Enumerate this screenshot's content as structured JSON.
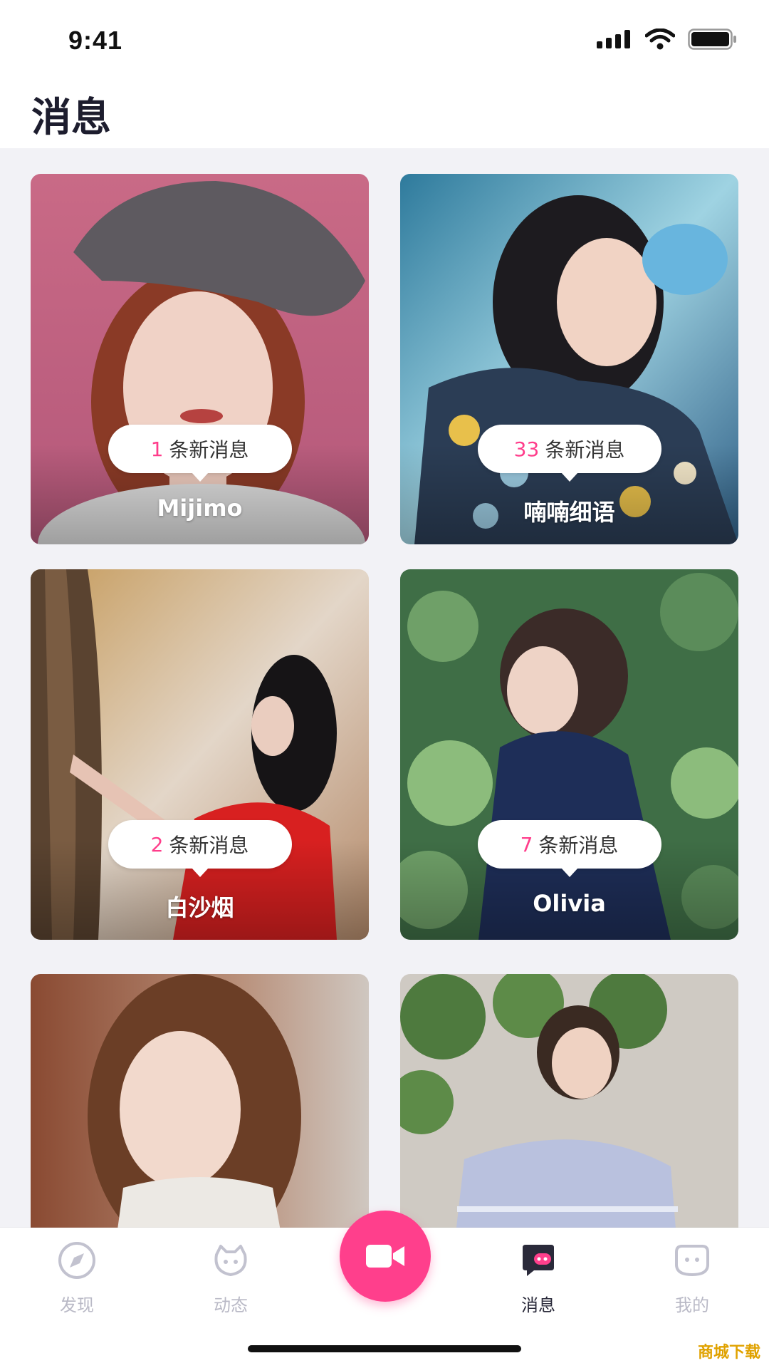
{
  "status_bar": {
    "time": "9:41"
  },
  "header": {
    "title": "消息"
  },
  "cards": [
    {
      "count": "1",
      "suffix": "条新消息",
      "name": "Mijimo"
    },
    {
      "count": "33",
      "suffix": "条新消息",
      "name": "喃喃细语"
    },
    {
      "count": "2",
      "suffix": "条新消息",
      "name": "白沙烟"
    },
    {
      "count": "7",
      "suffix": "条新消息",
      "name": "Olivia"
    }
  ],
  "tabs": [
    {
      "label": "发现",
      "icon": "compass-icon"
    },
    {
      "label": "动态",
      "icon": "cat-face-icon"
    },
    {
      "label": "",
      "icon": "video-camera-icon"
    },
    {
      "label": "消息",
      "icon": "chat-bubble-icon"
    },
    {
      "label": "我的",
      "icon": "face-icon"
    }
  ],
  "colors": {
    "accent": "#ff3f8c",
    "tab_inactive": "#b9b9c6",
    "tab_active": "#2a2a3a"
  },
  "watermark": "商城下载"
}
